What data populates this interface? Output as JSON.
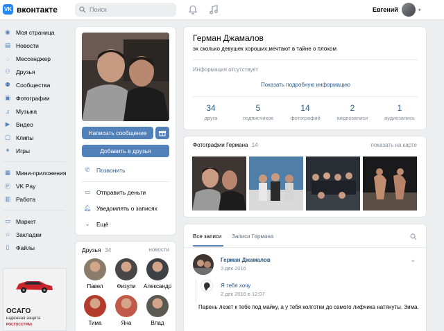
{
  "header": {
    "logo_letters": "VK",
    "logo_text": "вконтакте",
    "search_placeholder": "Поиск",
    "user_name": "Евгений"
  },
  "sidebar": {
    "main": [
      {
        "label": "Моя страница",
        "icon": "home-icon"
      },
      {
        "label": "Новости",
        "icon": "news-icon"
      },
      {
        "label": "Мессенджер",
        "icon": "messenger-icon"
      },
      {
        "label": "Друзья",
        "icon": "friends-icon"
      },
      {
        "label": "Сообщества",
        "icon": "communities-icon"
      },
      {
        "label": "Фотографии",
        "icon": "photos-icon"
      },
      {
        "label": "Музыка",
        "icon": "music-icon"
      },
      {
        "label": "Видео",
        "icon": "video-icon"
      },
      {
        "label": "Клипы",
        "icon": "clips-icon"
      },
      {
        "label": "Игры",
        "icon": "games-icon"
      }
    ],
    "apps": [
      {
        "label": "Мини-приложения",
        "icon": "mini-apps-icon"
      },
      {
        "label": "VK Pay",
        "icon": "vkpay-icon"
      },
      {
        "label": "Работа",
        "icon": "work-icon"
      }
    ],
    "extra": [
      {
        "label": "Маркет",
        "icon": "market-icon"
      },
      {
        "label": "Закладки",
        "icon": "bookmarks-icon"
      },
      {
        "label": "Файлы",
        "icon": "files-icon"
      }
    ],
    "ad": {
      "title": "ОСАГО",
      "subtitle": "надежная защита",
      "brand": "РОСГОССТРАХ"
    }
  },
  "profile_actions": {
    "message_button": "Написать сообщение",
    "add_friend_button": "Добавить в друзья",
    "call": "Позвонить",
    "send_money": "Отправить деньги",
    "notify": "Уведомлять о записях",
    "more": "Ещё"
  },
  "friends": {
    "title": "Друзья",
    "count": "34",
    "news_link": "новости",
    "items": [
      {
        "name": "Павел"
      },
      {
        "name": "Физули"
      },
      {
        "name": "Александр"
      },
      {
        "name": "Тима"
      },
      {
        "name": "Яна"
      },
      {
        "name": "Влад"
      }
    ]
  },
  "profile": {
    "name": "Герман Джамалов",
    "status": "эх сколько девушек хороших,мечтают в тайне о плохом",
    "info_missing": "Информация отсутствует",
    "show_more": "Показать подробную информацию",
    "counters": [
      {
        "value": "34",
        "label": "друга"
      },
      {
        "value": "5",
        "label": "подписчиков"
      },
      {
        "value": "14",
        "label": "фотографий"
      },
      {
        "value": "2",
        "label": "видеозаписи"
      },
      {
        "value": "1",
        "label": "аудиозапись"
      }
    ]
  },
  "photos": {
    "title": "Фотографии Германа",
    "count": "14",
    "map_link": "показать на карте"
  },
  "wall": {
    "tab_all": "Все записи",
    "tab_owner": "Записи Германа",
    "post": {
      "author": "Герман Джамалов",
      "date": "3 дек 2016",
      "repost_author": "Я тебя хочу",
      "repost_date": "2 дек 2016 в 12:07",
      "text": "Парень лезет к тебе под майку, а у тебя колготки до самого лифчика натянуты. Зима."
    }
  },
  "colors": {
    "accent": "#5181b8",
    "link": "#2a5885",
    "muted": "#818c99",
    "background": "#edeef0"
  }
}
